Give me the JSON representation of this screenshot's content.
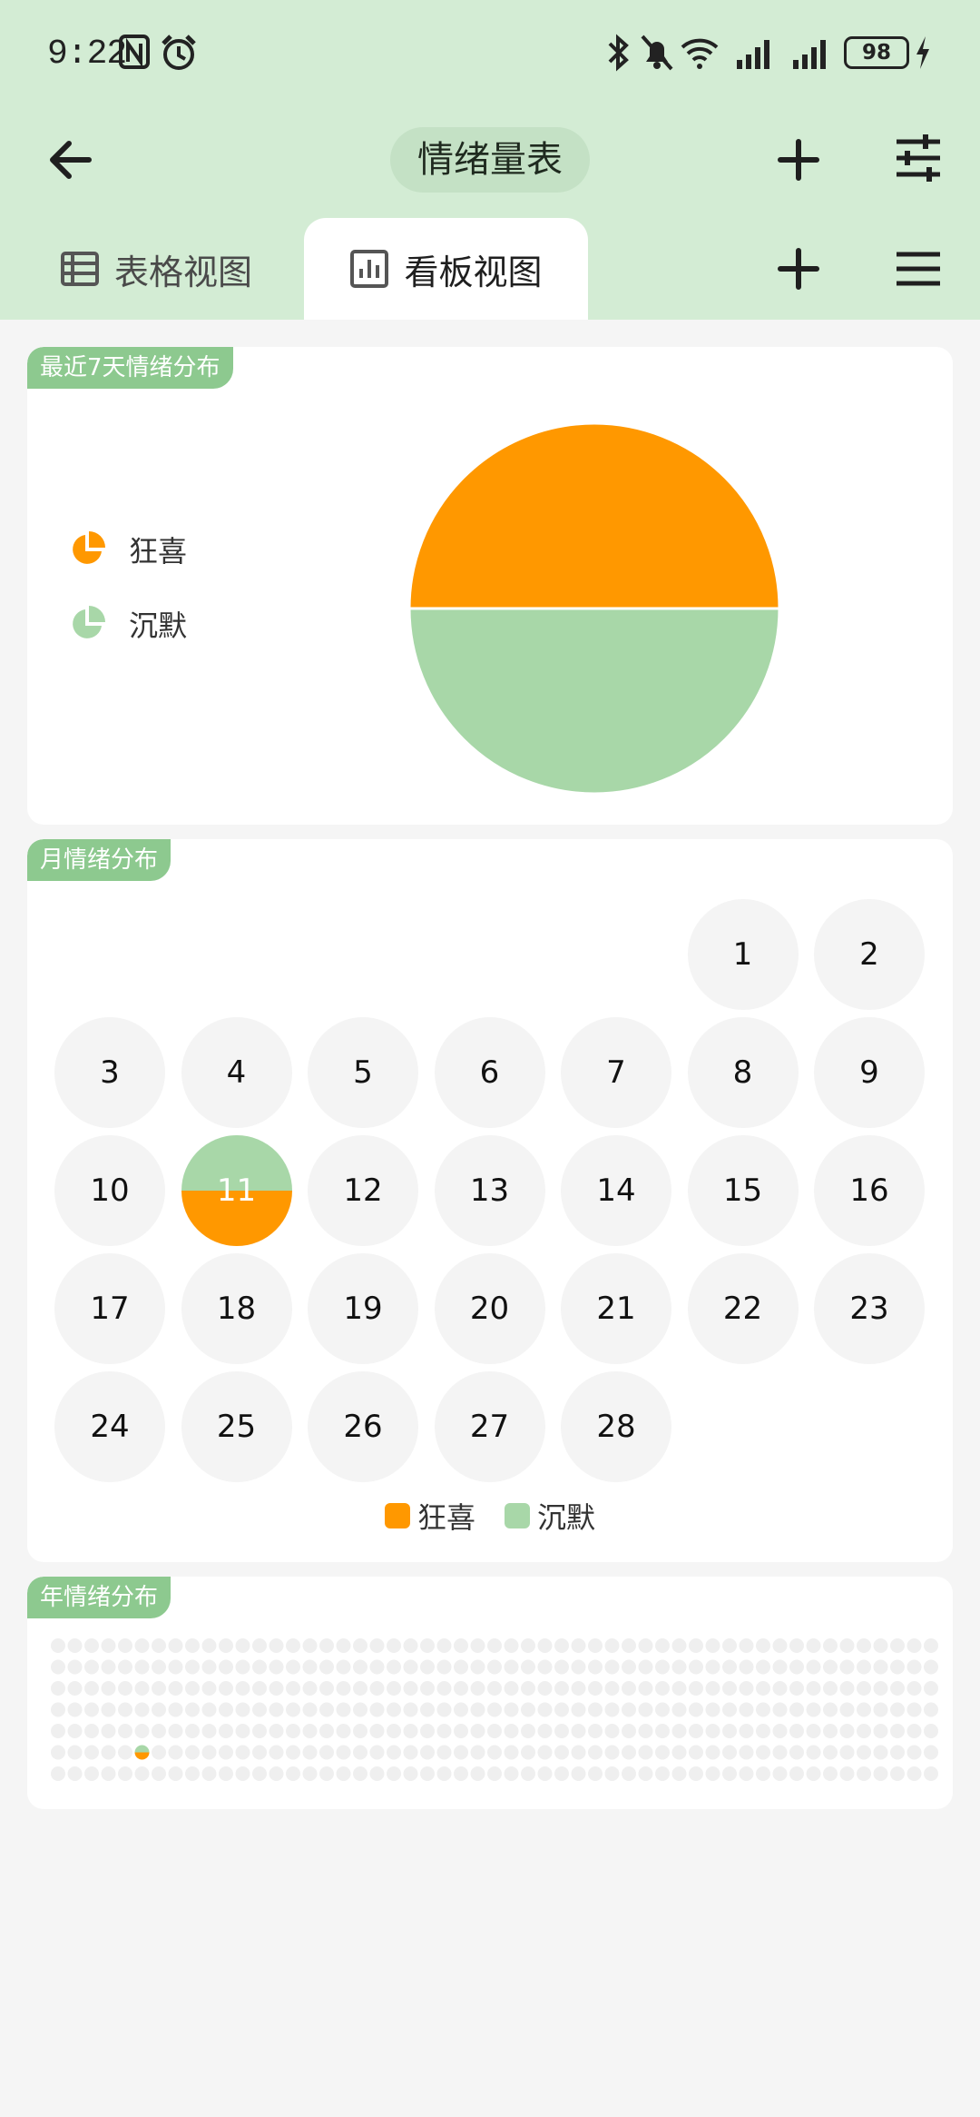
{
  "status": {
    "time": "9:22",
    "battery": "98"
  },
  "nav": {
    "title": "情绪量表"
  },
  "tabs": [
    {
      "label": "表格视图",
      "active": false
    },
    {
      "label": "看板视图",
      "active": true
    }
  ],
  "colors": {
    "joy": "#ff9800",
    "silent": "#a8d7a8",
    "header_bg": "#d3ecd4",
    "tag_bg": "#8dc98f"
  },
  "week_card": {
    "tag": "最近7天情绪分布",
    "legend": [
      {
        "label": "狂喜",
        "color": "#ff9800"
      },
      {
        "label": "沉默",
        "color": "#a8d7a8"
      }
    ]
  },
  "month_card": {
    "tag": "月情绪分布",
    "first_weekday_index": 5,
    "days": [
      "1",
      "2",
      "3",
      "4",
      "5",
      "6",
      "7",
      "8",
      "9",
      "10",
      "11",
      "12",
      "13",
      "14",
      "15",
      "16",
      "17",
      "18",
      "19",
      "20",
      "21",
      "22",
      "23",
      "24",
      "25",
      "26",
      "27",
      "28"
    ],
    "marked_day": "11",
    "legend": [
      {
        "label": "狂喜",
        "color": "#ff9800"
      },
      {
        "label": "沉默",
        "color": "#a8d7a8"
      }
    ]
  },
  "year_card": {
    "tag": "年情绪分布",
    "rows": 7,
    "cols": 53,
    "marked_cell": {
      "row": 5,
      "col": 5
    }
  },
  "chart_data": {
    "type": "pie",
    "categories": [
      "狂喜",
      "沉默"
    ],
    "values": [
      1,
      1
    ],
    "colors": [
      "#ff9800",
      "#a8d7a8"
    ],
    "legend": "left"
  }
}
